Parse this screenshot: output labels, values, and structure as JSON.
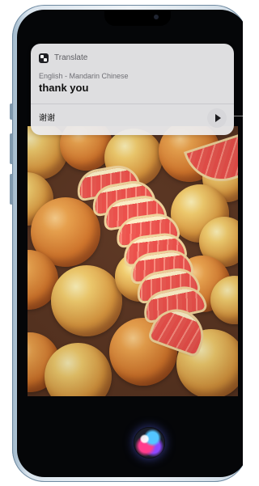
{
  "translate_card": {
    "app_name": "Translate",
    "language_pair": "English - Mandarin Chinese",
    "source_text": "thank you",
    "translated_text": "谢谢",
    "play_icon": "play-icon"
  },
  "siri": {
    "icon": "siri-icon"
  },
  "colors": {
    "screen_background": "#050608",
    "card_background": "#ECECEE",
    "text_primary": "#111111",
    "text_secondary": "#6F6F75"
  }
}
